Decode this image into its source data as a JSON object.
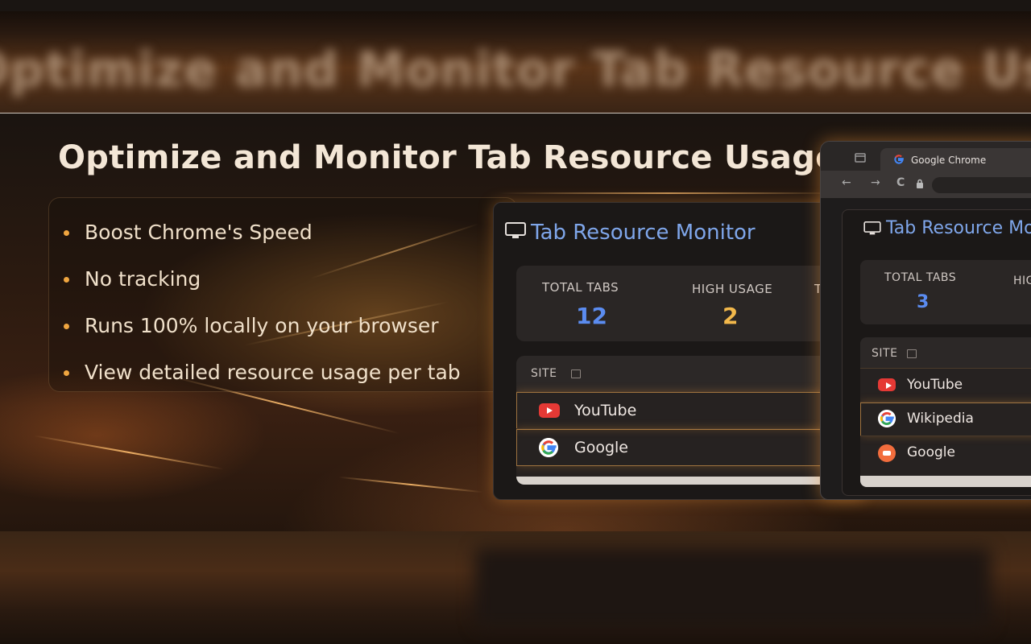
{
  "background": {
    "blurred_title": "Optimize and Monitor Tab Resource Usage"
  },
  "banner": {
    "headline": "Optimize and Monitor Tab Resource Usage",
    "features": [
      "Boost Chrome's Speed",
      "No tracking",
      "Runs 100% locally on your browser",
      "View detailed resource usage per tab"
    ]
  },
  "panel_main": {
    "title": "Tab Resource Monitor",
    "stats": [
      {
        "label": "TOTAL TABS",
        "value": "12",
        "color": "#5b8cf0"
      },
      {
        "label": "HIGH USAGE",
        "value": "2",
        "color": "#f2b84b"
      },
      {
        "label": "T"
      }
    ],
    "list_header": "SITE",
    "rows": [
      "YouTube",
      "Google"
    ]
  },
  "panel_browser": {
    "tab_title": "Google Chrome",
    "tab_close": "×",
    "nav": {
      "back": "←",
      "forward": "→",
      "reload": "C"
    },
    "title": "Tab Resource Mo",
    "stats": [
      {
        "label": "TOTAL TABS",
        "value": "3",
        "color": "#5b8cf0"
      },
      {
        "label": "HIGH"
      }
    ],
    "list_header": "SITE",
    "rows": [
      "YouTube",
      "Wikipedia",
      "Google"
    ]
  },
  "icons": [
    "monitor-icon",
    "youtube-icon",
    "google-icon",
    "sort-icon",
    "lock-icon"
  ]
}
